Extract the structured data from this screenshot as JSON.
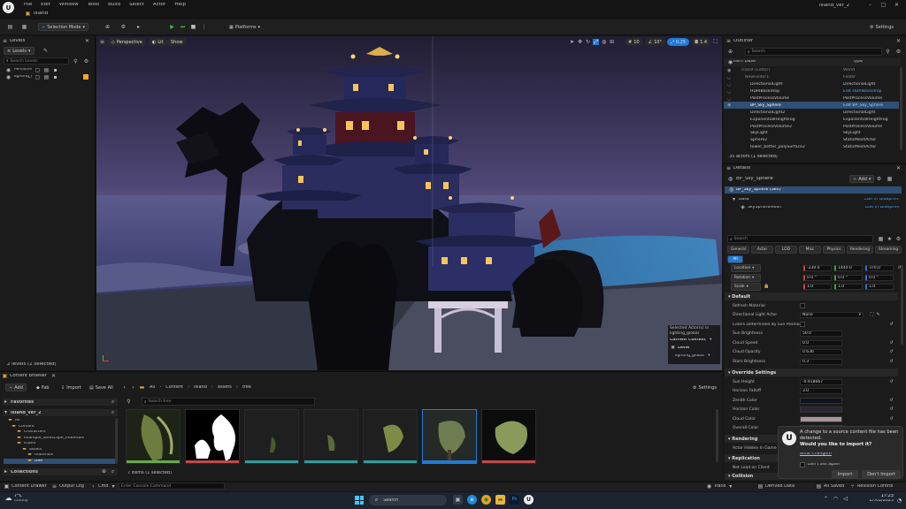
{
  "menu": {
    "items": [
      "File",
      "Edit",
      "Window",
      "Tools",
      "Build",
      "Select",
      "Actor",
      "Help"
    ],
    "project_name": "island_ver_2",
    "level_tab": "island"
  },
  "toolbar": {
    "selection_mode": "Selection Mode",
    "platforms": "Platforms",
    "settings": "Settings"
  },
  "viewport": {
    "perspective": "Perspective",
    "lit": "Lit",
    "show": "Show",
    "grid_snap": "10",
    "rot_snap": "10°",
    "scale_snap": "0.25",
    "cam_speed": "1.4",
    "context": {
      "selected": "Selected Actor(s) in",
      "selected_level": "lighting_global",
      "current_context": "Current Context",
      "level_label": "Level",
      "level_value": "lighting_global"
    }
  },
  "levels": {
    "tab": "Levels",
    "levels_btn": "Levels",
    "search_placeholder": "Search Levels",
    "rows": [
      "Persistent Level",
      "lighting_global"
    ],
    "footer": "2 levels (1 selected)"
  },
  "outliner": {
    "tab": "Outliner",
    "search_placeholder": "Search",
    "col_label": "Item Label",
    "col_type": "Type",
    "rows": [
      {
        "name": "island (Editor)",
        "type": "World"
      },
      {
        "name": "NewFolder1",
        "type": "Folder"
      },
      {
        "name": "DirectionalLight",
        "type": "DirectionalLight"
      },
      {
        "name": "HDRIBackdrop",
        "type": "Edit HDRIBackdrop"
      },
      {
        "name": "PostProcessVolume",
        "type": "PostProcessVolume"
      },
      {
        "name": "BP_Sky_Sphere",
        "type": "Edit BP_Sky_Sphere"
      },
      {
        "name": "DirectionalLight2",
        "type": "DirectionalLight"
      },
      {
        "name": "ExponentialHeightFog",
        "type": "ExponentialHeightFog"
      },
      {
        "name": "PostProcessVolume2",
        "type": "PostProcessVolume"
      },
      {
        "name": "SkyLight",
        "type": "SkyLight"
      },
      {
        "name": "Sphere2",
        "type": "StaticMeshActor"
      },
      {
        "name": "tower_better_polySurface2",
        "type": "StaticMeshActor"
      }
    ],
    "footer": "35 actors (1 selected)"
  },
  "details": {
    "tab": "Details",
    "actor": "BP_Sky_Sphere",
    "add": "Add",
    "self_label": "BP_Sky_Sphere (Self)",
    "base": "Base",
    "base_link": "Edit in Blueprint",
    "mesh": "SkySphereMesh",
    "mesh_link": "Edit in Blueprint",
    "search_placeholder": "Search",
    "tabs": [
      "General",
      "Actor",
      "LOD",
      "Misc",
      "Physics",
      "Rendering",
      "Streaming"
    ],
    "tab_all": "All",
    "location_label": "Location",
    "location": [
      "-230.0",
      "1440.0",
      "370.0"
    ],
    "rotation_label": "Rotation",
    "rotation": [
      "0.0 °",
      "0.0 °",
      "0.0 °"
    ],
    "scale_label": "Scale",
    "scale": [
      "1.0",
      "1.0",
      "1.0"
    ],
    "default_section": "Default",
    "refresh_material": "Refresh Material",
    "dir_light_actor": "Directional Light Actor",
    "dir_light_value": "None",
    "colors_by_sun": "Colors Determined By Sun Position",
    "sun_brightness": "Sun Brightness",
    "sun_brightness_value": "50.0",
    "cloud_speed": "Cloud Speed",
    "cloud_speed_value": "0.0",
    "cloud_opacity": "Cloud Opacity",
    "cloud_opacity_value": "0.636",
    "stars_brightness": "Stars Brightness",
    "stars_brightness_value": "0.3",
    "override_section": "Override Settings",
    "sun_height": "Sun Height",
    "sun_height_value": "-0.918667",
    "horizon_falloff": "Horizon Falloff",
    "horizon_falloff_value": "3.0",
    "zenith_color": "Zenith Color",
    "horizon_color": "Horizon Color",
    "cloud_color": "Cloud Color",
    "overall_color": "Overall Color",
    "rendering_section": "Rendering",
    "actor_hidden": "Actor Hidden In Game",
    "replication_section": "Replication",
    "net_load": "Net Load on Client",
    "collision_section": "Collision"
  },
  "content_browser": {
    "tab": "Content Browser",
    "add": "Add",
    "fab": "Fab",
    "import": "Import",
    "save_all": "Save All",
    "settings": "Settings",
    "path": [
      "All",
      "Content",
      "island",
      "assets",
      "tree"
    ],
    "favorites": "Favorites",
    "project": "island_ver_2",
    "tree": [
      "All",
      "Content",
      "Characters",
      "example_landscape_materials",
      "island",
      "assets",
      "materials",
      "tree"
    ],
    "search_placeholder": "Search tree",
    "footer": "7 items (1 selected)",
    "collections": "Collections"
  },
  "statusbar": {
    "content_drawer": "Content Drawer",
    "output_log": "Output Log",
    "cmd": "Cmd",
    "console_placeholder": "Enter Console Command",
    "trace": "Trace",
    "derived_data": "Derived Data",
    "all_saved": "All Saved",
    "revision_control": "Revision Control"
  },
  "toast": {
    "title": "A change to a source content file has been detected.",
    "question": "Would you like to import it?",
    "link": "What Changed?",
    "dont_ask": "Don't ask again",
    "import": "Import",
    "dont_import": "Don't Import"
  },
  "taskbar": {
    "temp": "7°C",
    "weather": "Cloudy",
    "search": "Search",
    "time": "17:23",
    "date": "17/01/2025"
  },
  "colors": {
    "accent": "#1e7bd6",
    "selection": "#2f4f74",
    "play_green": "#3fc13f",
    "folder_yellow": "#d3a94a"
  }
}
